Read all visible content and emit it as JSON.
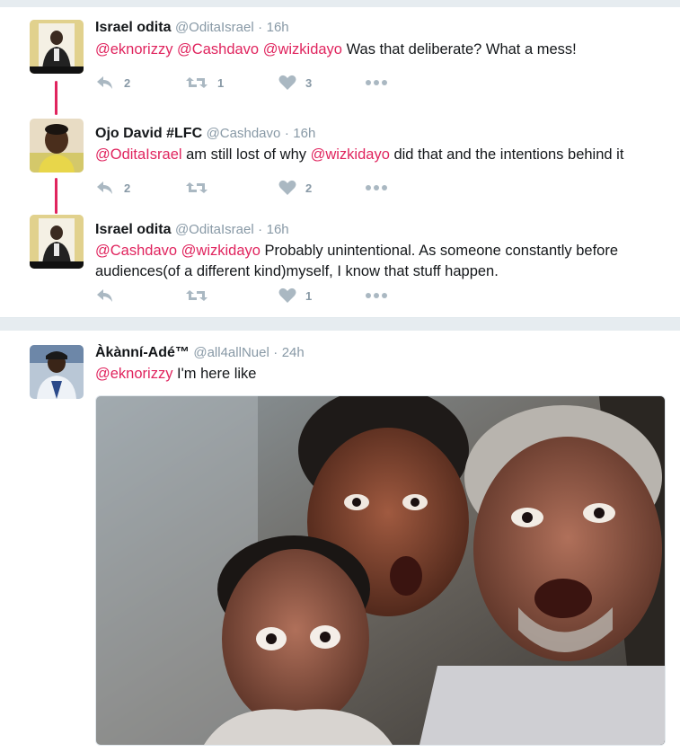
{
  "tweets": [
    {
      "name": "Israel odita",
      "handle": "@OditaIsrael",
      "time": "16h",
      "text_parts": [
        {
          "t": "@eknorizzy",
          "m": true
        },
        {
          "t": " ",
          "m": false
        },
        {
          "t": "@Cashdavo",
          "m": true
        },
        {
          "t": " ",
          "m": false
        },
        {
          "t": "@wizkidayo",
          "m": true
        },
        {
          "t": " Was that deliberate? What a mess!",
          "m": false
        }
      ],
      "reply_count": "2",
      "retweet_count": "1",
      "like_count": "3"
    },
    {
      "name": "Ojo David #LFC",
      "handle": "@Cashdavo",
      "time": "16h",
      "text_parts": [
        {
          "t": "@OditaIsrael",
          "m": true
        },
        {
          "t": " am still lost of why  ",
          "m": false
        },
        {
          "t": "@wizkidayo",
          "m": true
        },
        {
          "t": " did that and the intentions behind it",
          "m": false
        }
      ],
      "reply_count": "2",
      "retweet_count": "",
      "like_count": "2"
    },
    {
      "name": "Israel odita",
      "handle": "@OditaIsrael",
      "time": "16h",
      "text_parts": [
        {
          "t": "@Cashdavo",
          "m": true
        },
        {
          "t": " ",
          "m": false
        },
        {
          "t": "@wizkidayo",
          "m": true
        },
        {
          "t": " Probably unintentional. As someone constantly before audiences(of a different kind)myself, I know that stuff happen.",
          "m": false
        }
      ],
      "reply_count": "",
      "retweet_count": "",
      "like_count": "1"
    },
    {
      "name": "Àkànní-Adé™",
      "handle": "@all4allNuel",
      "time": "24h",
      "text_parts": [
        {
          "t": "@eknorizzy",
          "m": true
        },
        {
          "t": " I'm here like",
          "m": false
        }
      ]
    }
  ],
  "dot": "·",
  "icons": {
    "reply": "reply-icon",
    "retweet": "retweet-icon",
    "like": "heart-icon",
    "more": "more-icon"
  },
  "colors": {
    "mention": "#e0245e",
    "meta": "#8899a6",
    "action": "#aab8c2",
    "thread": "#e0245e"
  }
}
